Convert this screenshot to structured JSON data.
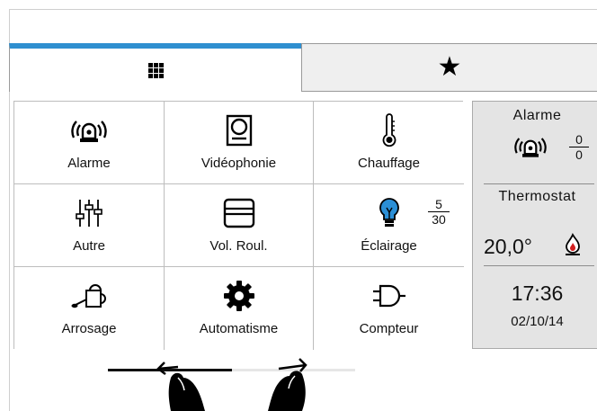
{
  "colors": {
    "accent": "#2f8fd0",
    "sidebar_bg": "#e4e4e4",
    "tab_inactive_bg": "#efefef",
    "flame": "#d22020",
    "bulb": "#2b8fd6"
  },
  "tabs": [
    {
      "name": "home-grid",
      "icon": "grid-icon",
      "active": true
    },
    {
      "name": "favorites",
      "icon": "star-icon",
      "label": "★",
      "active": false
    }
  ],
  "tiles": [
    {
      "label": "Alarme",
      "icon": "alarm-icon"
    },
    {
      "label": "Vidéophonie",
      "icon": "intercom-icon"
    },
    {
      "label": "Chauffage",
      "icon": "thermometer-icon"
    },
    {
      "label": "Autre",
      "icon": "sliders-icon"
    },
    {
      "label": "Vol. Roul.",
      "icon": "roller-shutter-icon"
    },
    {
      "label": "Éclairage",
      "icon": "bulb-icon",
      "count_on": "5",
      "count_total": "30"
    },
    {
      "label": "Arrosage",
      "icon": "watering-can-icon"
    },
    {
      "label": "Automatisme",
      "icon": "gear-icon"
    },
    {
      "label": "Compteur",
      "icon": "plug-icon"
    }
  ],
  "sidebar": {
    "alarm": {
      "title": "Alarme",
      "icon": "alarm-icon",
      "active": "0",
      "total": "0"
    },
    "thermostat": {
      "title": "Thermostat",
      "temperature": "20,0°",
      "icon": "flame-icon"
    },
    "clock": {
      "time": "17:36",
      "date": "02/10/14"
    }
  },
  "pager": {
    "pages": 2,
    "current": 1
  },
  "gesture": {
    "icon": "swipe-hands-icon"
  }
}
